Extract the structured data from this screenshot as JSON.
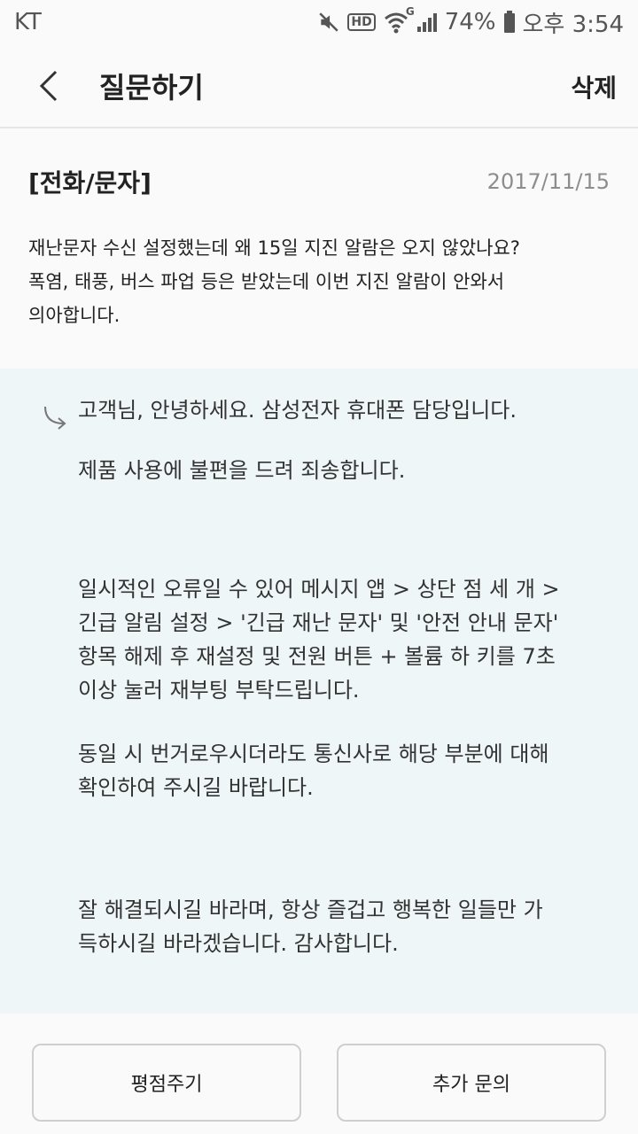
{
  "status_bar": {
    "carrier": "KT",
    "battery": "74%",
    "time": "오후 3:54",
    "hd_label": "HD",
    "network_label": "G"
  },
  "header": {
    "title": "질문하기",
    "delete_label": "삭제"
  },
  "question": {
    "category": "[전화/문자]",
    "date": "2017/11/15",
    "body": "재난문자 수신 설정했는데 왜 15일 지진 알람은 오지 않았나요?\n폭염, 태풍, 버스 파업 등은 받았는데 이번 지진 알람이 안와서\n의아합니다."
  },
  "answer": {
    "paragraphs": [
      "고객님, 안녕하세요. 삼성전자 휴대폰 담당입니다.",
      "제품 사용에 불편을 드려 죄송합니다.",
      "일시적인 오류일 수 있어 메시지 앱 > 상단 점 세 개 >\n긴급 알림 설정 > '긴급 재난 문자' 및 '안전 안내 문자'\n항목 해제 후 재설정 및 전원 버튼 + 볼륨 하 키를 7초\n이상 눌러 재부팅 부탁드립니다.",
      "동일 시 번거로우시더라도 통신사로 해당 부분에 대해\n확인하여 주시길 바랍니다.",
      "잘 해결되시길 바라며, 항상 즐겁고 행복한 일들만 가\n득하시길 바라겠습니다. 감사합니다."
    ]
  },
  "actions": {
    "rate_label": "평점주기",
    "inquiry_label": "추가 문의"
  },
  "icons": {
    "mute": "mute-icon",
    "hd": "hd-icon",
    "wifi": "wifi-icon",
    "signal": "signal-icon",
    "battery": "battery-icon",
    "back": "back-arrow-icon",
    "reply": "reply-arrow-icon"
  }
}
